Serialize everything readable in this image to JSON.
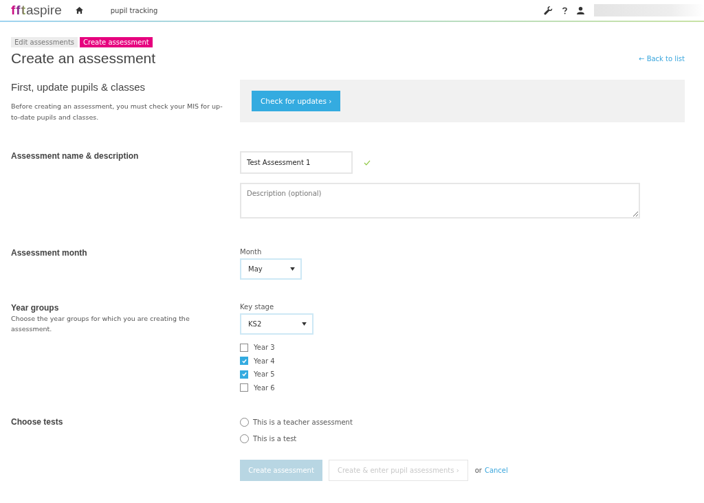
{
  "header": {
    "logo": {
      "mark": "fft",
      "word": "aspire"
    },
    "nav": "pupil tracking"
  },
  "breadcrumbs": [
    {
      "label": "Edit assessments",
      "selected": false
    },
    {
      "label": "Create assessment",
      "selected": true
    }
  ],
  "page_title": "Create an assessment",
  "back_link": "← Back to list",
  "update_section": {
    "heading": "First, update pupils & classes",
    "text": "Before creating an assessment, you must check your MIS for up-to-date pupils and classes.",
    "button": "Check for updates ›"
  },
  "name_section": {
    "label": "Assessment name & description",
    "name_value": "Test Assessment 1",
    "valid": true,
    "description_placeholder": "Description (optional)"
  },
  "month_section": {
    "label": "Assessment month",
    "field_label": "Month",
    "value": "May"
  },
  "year_section": {
    "label": "Year groups",
    "help": "Choose the year groups for which you are creating the assessment.",
    "field_label": "Key stage",
    "value": "KS2",
    "years": [
      {
        "label": "Year 3",
        "checked": false
      },
      {
        "label": "Year 4",
        "checked": true
      },
      {
        "label": "Year 5",
        "checked": true
      },
      {
        "label": "Year 6",
        "checked": false
      }
    ]
  },
  "tests_section": {
    "label": "Choose tests",
    "options": [
      {
        "label": "This is a teacher assessment",
        "selected": false
      },
      {
        "label": "This is a test",
        "selected": false
      }
    ]
  },
  "actions": {
    "primary": {
      "label": "Create assessment",
      "disabled": true
    },
    "secondary": {
      "label": "Create & enter pupil assessments ›",
      "disabled": true
    },
    "or_text": "or",
    "cancel": "Cancel"
  }
}
